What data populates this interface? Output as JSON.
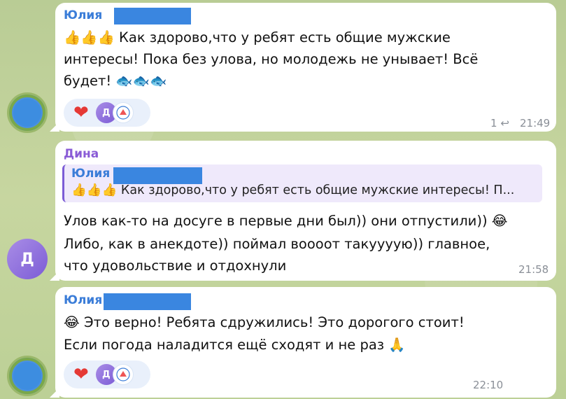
{
  "messages": [
    {
      "sender": "Юлия",
      "line1": "👍👍👍 Как здорово,что у ребят есть общие мужские",
      "line2": "интересы! Пока без улова, но молодежь не унывает! Всё",
      "line3": "будет! 🐟🐟🐟",
      "reaction_heart": "❤",
      "reaction_avatar": "Д",
      "reply_count": "1",
      "reply_icon": "↩",
      "time": "21:49"
    },
    {
      "sender": "Дина",
      "avatar_letter": "Д",
      "quote_sender": "Юлия",
      "quote_text": "👍👍👍 Как здорово,что у ребят есть общие мужские интересы! П...",
      "line1": "Улов как-то на досуге в первые дни был)) они отпустили)) 😂",
      "line2": "Либо, как в анекдоте)) поймал вооoот такуууую)) главное,",
      "line3": "что удовольствие и отдохнули",
      "time": "21:58"
    },
    {
      "sender": "Юлия",
      "line1": "😂  Это верно! Ребята сдружились! Это дорогого стоит!",
      "line2": "Если погода наладится ещё сходят и не раз 🙏",
      "reaction_heart": "❤",
      "reaction_avatar": "Д",
      "time": "22:10"
    }
  ],
  "colors": {
    "sender_julia": "#3b7dd8",
    "sender_dina": "#8a5cd6",
    "redaction": "#3a86e0",
    "bubble": "#ffffff",
    "background": "#c3d39a"
  }
}
